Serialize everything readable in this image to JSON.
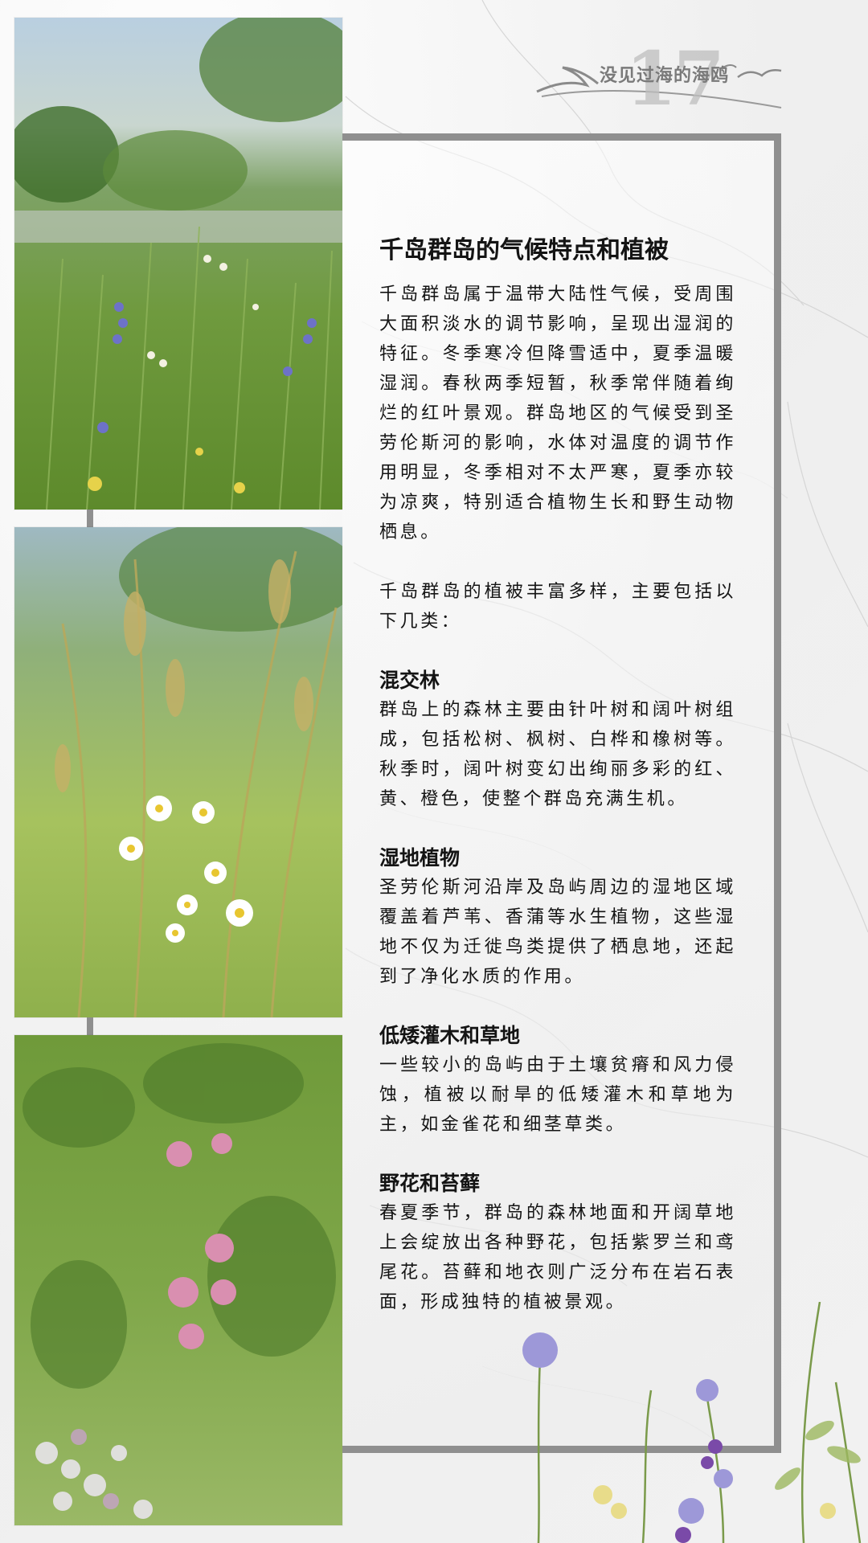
{
  "logo": {
    "number": "17",
    "text": "没见过海的海鸥"
  },
  "article": {
    "title": "千岛群岛的气候特点和植被",
    "intro": "千岛群岛属于温带大陆性气候，受周围大面积淡水的调节影响，呈现出湿润的特征。冬季寒冷但降雪适中，夏季温暖湿润。春秋两季短暂，秋季常伴随着绚烂的红叶景观。群岛地区的气候受到圣劳伦斯河的影响，水体对温度的调节作用明显，冬季相对不太严寒，夏季亦较为凉爽，特别适合植物生长和野生动物栖息。",
    "lead": "千岛群岛的植被丰富多样，主要包括以下几类：",
    "sections": [
      {
        "title": "混交林",
        "text": "群岛上的森林主要由针叶树和阔叶树组成，包括松树、枫树、白桦和橡树等。秋季时，阔叶树变幻出绚丽多彩的红、黄、橙色，使整个群岛充满生机。"
      },
      {
        "title": "湿地植物",
        "text": "圣劳伦斯河沿岸及岛屿周边的湿地区域覆盖着芦苇、香蒲等水生植物，这些湿地不仅为迁徙鸟类提供了栖息地，还起到了净化水质的作用。"
      },
      {
        "title": "低矮灌木和草地",
        "text": "一些较小的岛屿由于土壤贫瘠和风力侵蚀，植被以耐旱的低矮灌木和草地为主，如金雀花和细茎草类。"
      },
      {
        "title": "野花和苔藓",
        "text": "春夏季节，群岛的森林地面和开阔草地上会绽放出各种野花，包括紫罗兰和鸢尾花。苔藓和地衣则广泛分布在岩石表面，形成独特的植被景观。"
      }
    ]
  },
  "colors": {
    "panel_border": "#8f8f8f",
    "text": "#141414"
  }
}
